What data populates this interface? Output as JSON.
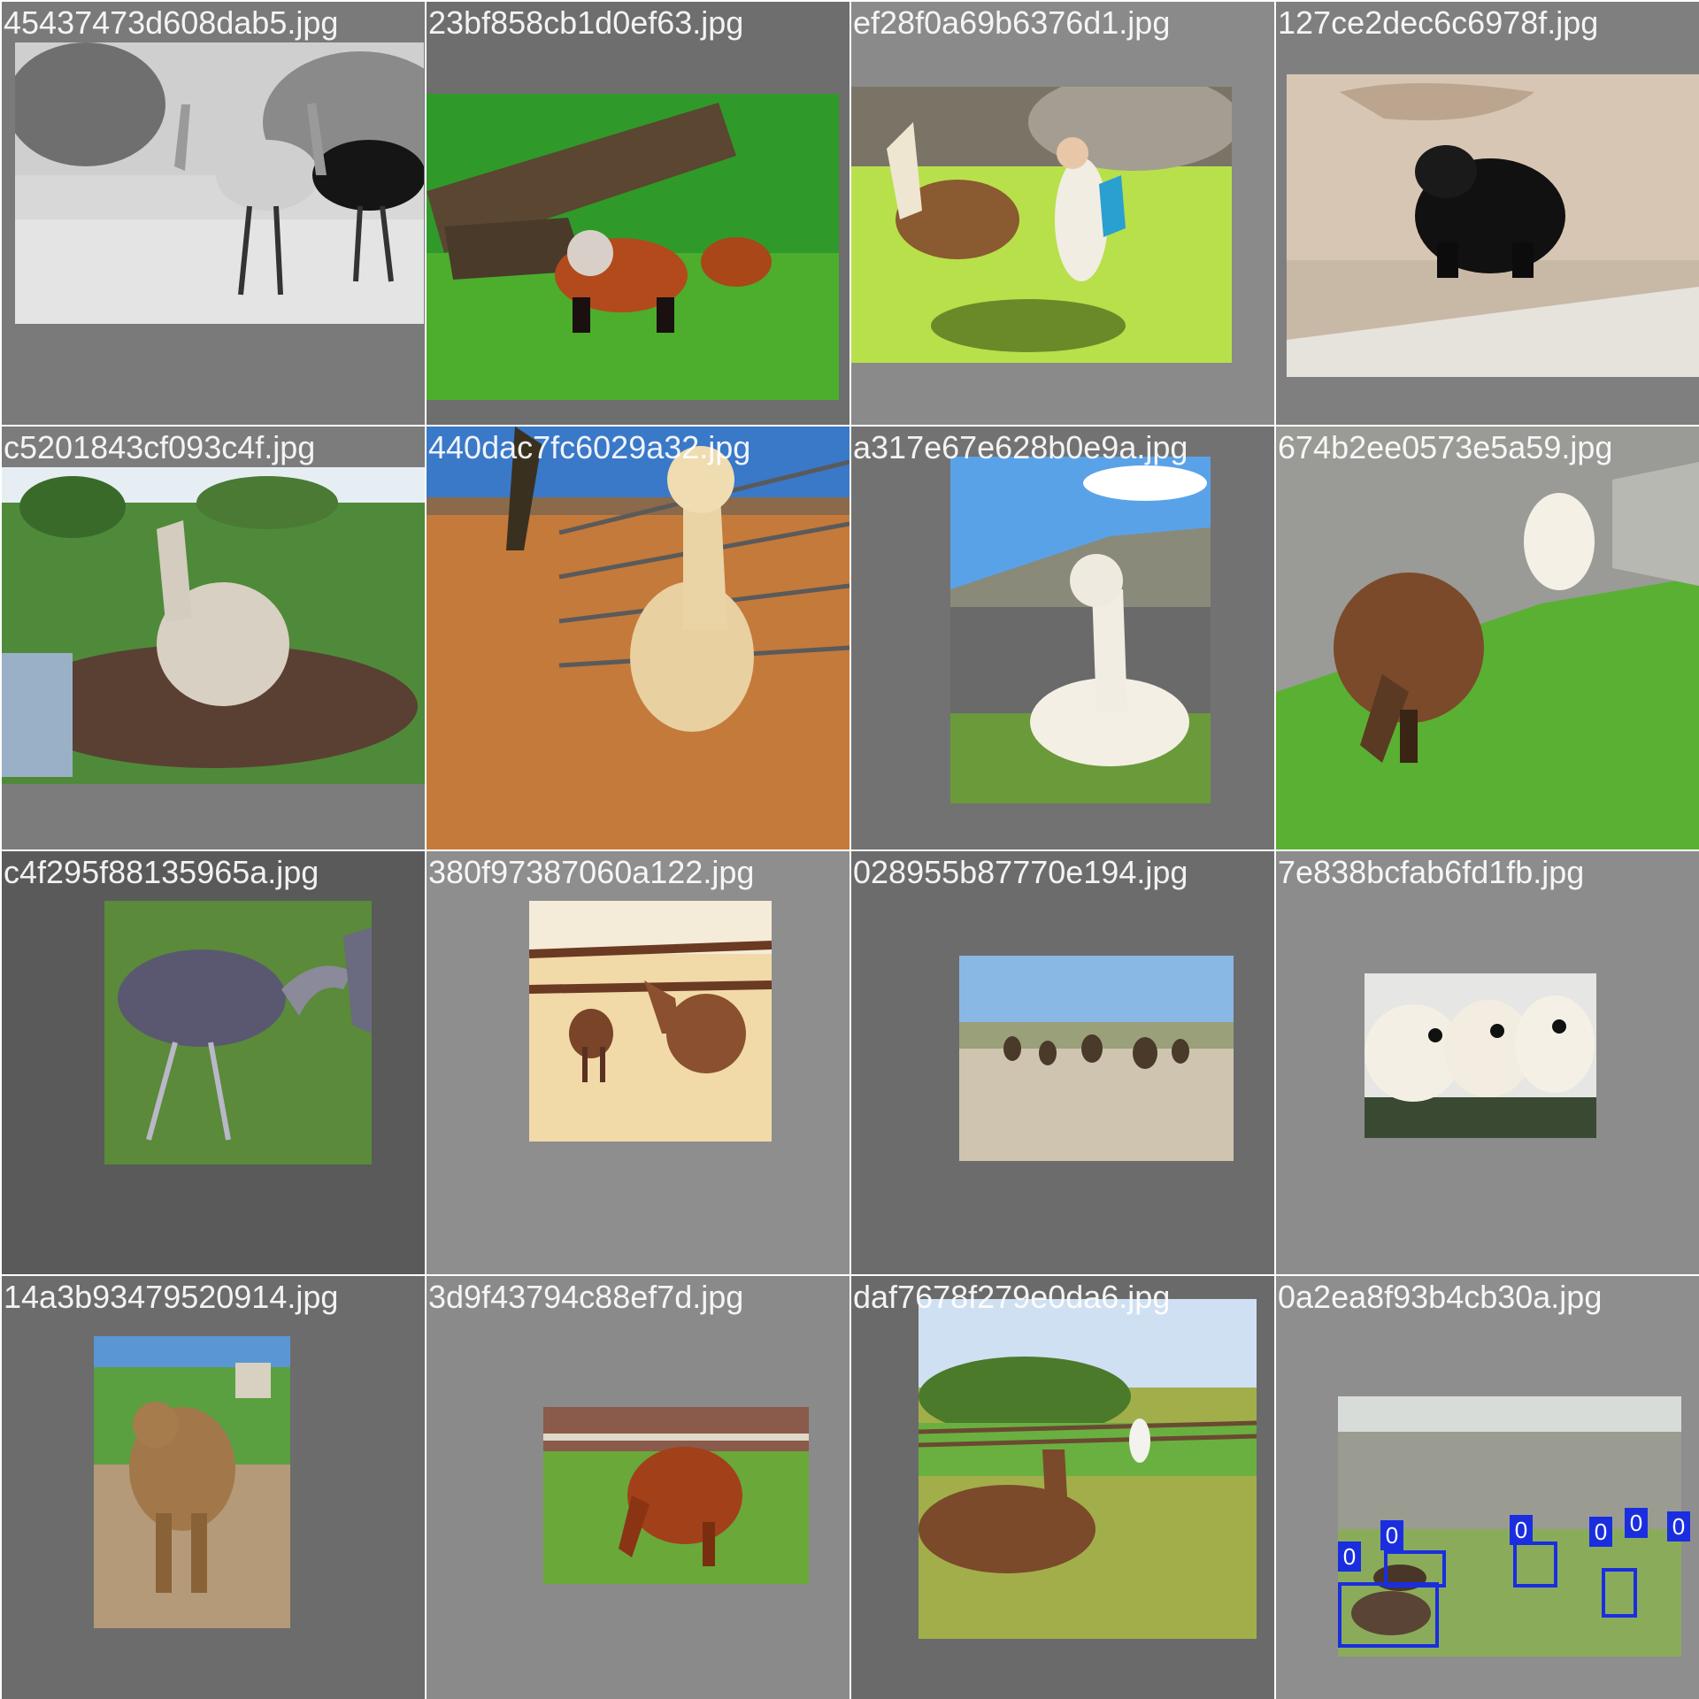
{
  "mosaic": {
    "tiles": [
      {
        "filename": "45437473d608dab5.jpg",
        "bg": "#7a7a7a"
      },
      {
        "filename": "23bf858cb1d0ef63.jpg",
        "bg": "#6e6e6e"
      },
      {
        "filename": "ef28f0a69b6376d1.jpg",
        "bg": "#8a8a8a"
      },
      {
        "filename": "127ce2dec6c6978f.jpg",
        "bg": "#7f7f7f"
      },
      {
        "filename": "c5201843cf093c4f.jpg",
        "bg": "#7c7c7c"
      },
      {
        "filename": "440dac7fc6029a32.jpg",
        "bg": "#7c7c7c"
      },
      {
        "filename": "a317e67e628b0e9a.jpg",
        "bg": "#727272"
      },
      {
        "filename": "674b2ee0573e5a59.jpg",
        "bg": "#7c7c7c"
      },
      {
        "filename": "c4f295f88135965a.jpg",
        "bg": "#5a5a5a"
      },
      {
        "filename": "380f97387060a122.jpg",
        "bg": "#8e8e8e"
      },
      {
        "filename": "028955b87770e194.jpg",
        "bg": "#6c6c6c"
      },
      {
        "filename": "7e838bcfab6fd1fb.jpg",
        "bg": "#8c8c8c"
      },
      {
        "filename": "14a3b93479520914.jpg",
        "bg": "#6c6c6c"
      },
      {
        "filename": "3d9f43794c88ef7d.jpg",
        "bg": "#8a8a8a"
      },
      {
        "filename": "daf7678f279e0da6.jpg",
        "bg": "#6a6a6a"
      },
      {
        "filename": "0a2ea8f93b4cb30a.jpg",
        "bg": "#8e8e8e"
      }
    ],
    "box_label": "0",
    "box_color": "#1a2ee0"
  }
}
